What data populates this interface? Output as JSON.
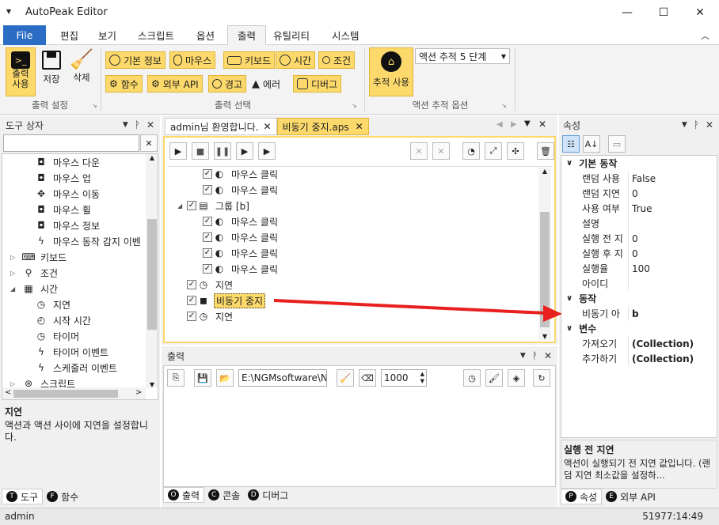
{
  "app": {
    "title": "AutoPeak Editor",
    "menu_glyph": "▾"
  },
  "window": {
    "minimize": "—",
    "maximize": "☐",
    "close": "✕"
  },
  "ribbon_tabs": [
    "File",
    "편집",
    "보기",
    "스크립트",
    "옵션",
    "출력",
    "유틸리티",
    "시스템"
  ],
  "ribbon": {
    "output_settings": {
      "label": "출력 설정",
      "buttons": [
        "출력\n사용",
        "저장",
        "삭제"
      ]
    },
    "output_select": {
      "label": "출력 선택",
      "row1": [
        "기본 정보",
        "마우스",
        "키보드",
        "시간",
        "조건"
      ],
      "row2": [
        "함수",
        "외부 API",
        "경고",
        "에러",
        "디버그"
      ]
    },
    "trace_options": {
      "label": "액션 추적 옵션",
      "button": "추적 사용",
      "dropdown": "액션 추적 5 단계"
    }
  },
  "toolbox": {
    "title": "도구 상자",
    "items": [
      {
        "label": "마우스 다운",
        "icon": "mouse-icon",
        "indent": 2
      },
      {
        "label": "마우스 업",
        "icon": "mouse-icon",
        "indent": 2
      },
      {
        "label": "마우스 이동",
        "icon": "move-icon",
        "indent": 2
      },
      {
        "label": "마우스 휠",
        "icon": "mouse-icon",
        "indent": 2
      },
      {
        "label": "마우스 정보",
        "icon": "mouse-icon",
        "indent": 2
      },
      {
        "label": "마우스 동작 감지 이벤",
        "icon": "bolt-icon",
        "indent": 2
      },
      {
        "label": "키보드",
        "icon": "keyboard-icon",
        "indent": 1,
        "arrow": "▷"
      },
      {
        "label": "조건",
        "icon": "condition-icon",
        "indent": 1,
        "arrow": "▷"
      },
      {
        "label": "시간",
        "icon": "calendar-icon",
        "indent": 1,
        "arrow": "◢"
      },
      {
        "label": "지연",
        "icon": "timer-icon",
        "indent": 2
      },
      {
        "label": "시작 시간",
        "icon": "clock24-icon",
        "indent": 2
      },
      {
        "label": "타이머",
        "icon": "timer-icon",
        "indent": 2
      },
      {
        "label": "타이머 이벤트",
        "icon": "bolt-icon",
        "indent": 2
      },
      {
        "label": "스케줄러 이벤트",
        "icon": "bolt-icon",
        "indent": 2
      },
      {
        "label": "스크립트",
        "icon": "script-icon",
        "indent": 1,
        "arrow": "▷"
      }
    ],
    "desc_title": "지연",
    "desc_text": "액션과 액션 사이에 지연을 설정합니다.",
    "tabs": [
      {
        "letter": "T",
        "label": "도구"
      },
      {
        "letter": "F",
        "label": "함수"
      }
    ]
  },
  "doc_tabs": [
    {
      "label": "admin님 환영합니다."
    },
    {
      "label": "비동기 중지.aps",
      "active": true
    }
  ],
  "script_tree": [
    {
      "label": "마우스 클릭",
      "indent": 2,
      "icon": "click-icon"
    },
    {
      "label": "마우스 클릭",
      "indent": 2,
      "icon": "click-icon"
    },
    {
      "label": "그룹 [b]",
      "indent": 1,
      "icon": "group-icon",
      "arrow": "◢"
    },
    {
      "label": "마우스 클릭",
      "indent": 2,
      "icon": "click-icon"
    },
    {
      "label": "마우스 클릭",
      "indent": 2,
      "icon": "click-icon"
    },
    {
      "label": "마우스 클릭",
      "indent": 2,
      "icon": "click-icon"
    },
    {
      "label": "마우스 클릭",
      "indent": 2,
      "icon": "click-icon"
    },
    {
      "label": "지연",
      "indent": 1,
      "icon": "timer-icon"
    },
    {
      "label": "비동기 중지",
      "indent": 1,
      "icon": "stop-icon",
      "selected": true
    },
    {
      "label": "지연",
      "indent": 1,
      "icon": "timer-icon"
    }
  ],
  "output": {
    "title": "출력",
    "path": "E:\\NGMsoftware\\NG",
    "count": "1000",
    "tabs": [
      {
        "letter": "O",
        "label": "출력"
      },
      {
        "letter": "C",
        "label": "콘솔"
      },
      {
        "letter": "D",
        "label": "디버그"
      }
    ]
  },
  "properties": {
    "title": "속성",
    "categories": [
      {
        "name": "기본 동작",
        "rows": [
          [
            "랜덤 사용",
            "False"
          ],
          [
            "랜덤 지연",
            "0"
          ],
          [
            "사용 여부",
            "True"
          ],
          [
            "설명",
            ""
          ],
          [
            "실행 전 지",
            "0"
          ],
          [
            "실행 후 지",
            "0"
          ],
          [
            "실행율",
            "100"
          ],
          [
            "아이디",
            ""
          ]
        ]
      },
      {
        "name": "동작",
        "rows": [
          [
            "비동기 아",
            "b"
          ]
        ]
      },
      {
        "name": "변수",
        "rows": [
          [
            "가져오기",
            "(Collection)"
          ],
          [
            "추가하기",
            "(Collection)"
          ]
        ]
      }
    ],
    "desc_title": "실행 전 지연",
    "desc_text": "액션이 실행되기 전 지연 값입니다. (랜덤 지연 최소값을 설정하...",
    "tabs": [
      {
        "letter": "P",
        "label": "속성"
      },
      {
        "letter": "E",
        "label": "외부 API"
      }
    ]
  },
  "status": {
    "user": "admin",
    "time": "51977:14:49"
  },
  "colors": {
    "accent": "#2b6cc4",
    "yellow": "#fcd96a",
    "arrow": "#e8201e"
  }
}
